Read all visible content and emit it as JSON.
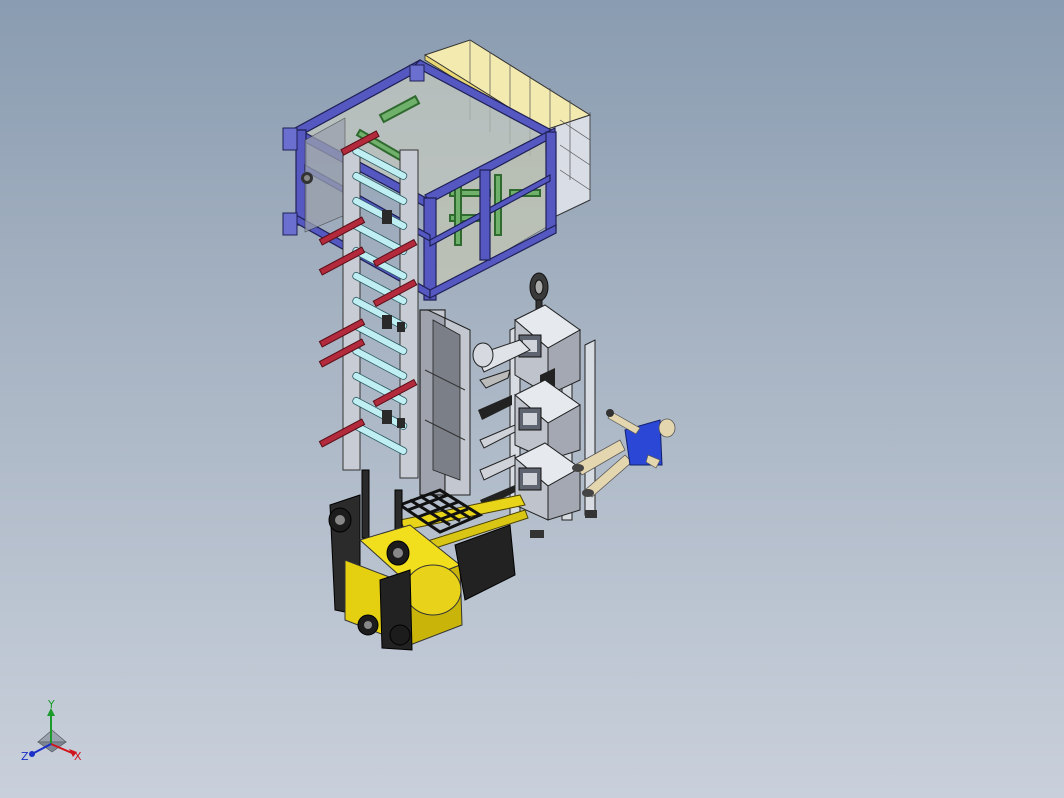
{
  "triad": {
    "x_label": "X",
    "y_label": "Y",
    "z_label": "Z",
    "x_color": "#d0141b",
    "y_color": "#1a9b2a",
    "z_color": "#1b2fc9"
  },
  "colors": {
    "background_top": "#8a9cb1",
    "background_bottom": "#c9d0db",
    "frame": "#4b4fb0",
    "frame_yellow": "#f0e6a0",
    "green_parts": "#4f9a4f",
    "red_arms": "#b0283a",
    "rollers": "#a8e6ee",
    "forklift_yellow": "#e8d51a",
    "forklift_dark": "#2a2a2a",
    "human_shirt": "#2a46d8",
    "human_skin": "#d8c8a0"
  },
  "parts": [
    "top-frame-assembly",
    "vertical-lift-column",
    "gripper-carriages",
    "forklift-agv",
    "human-figure"
  ]
}
